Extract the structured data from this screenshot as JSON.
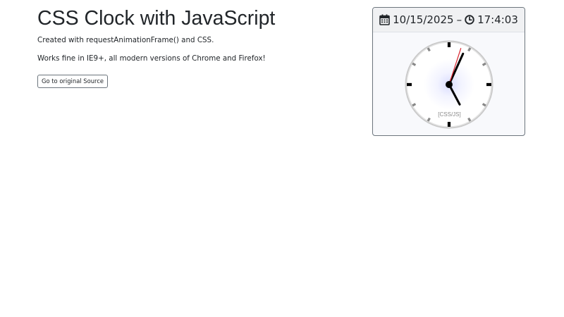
{
  "header": {
    "title": "CSS Clock with JavaScript"
  },
  "main": {
    "description_1": "Created with requestAnimationFrame() and CSS.",
    "description_2": "Works fine in IE9+, all modern versions of Chrome and Firefox!",
    "source_button_label": "Go to original Source"
  },
  "clock_card": {
    "date": "10/15/2025",
    "separator": "–",
    "time": "17:4:03",
    "date_icon": "calendar-icon",
    "time_icon": "clock-icon",
    "face_label": "[CSS/JS]",
    "hands": {
      "hour": 17,
      "minute": 4,
      "second": 3
    }
  },
  "colors": {
    "text": "#212529",
    "second_hand": "#d9232d",
    "hand": "#000000",
    "card_border": "#6c757d"
  }
}
